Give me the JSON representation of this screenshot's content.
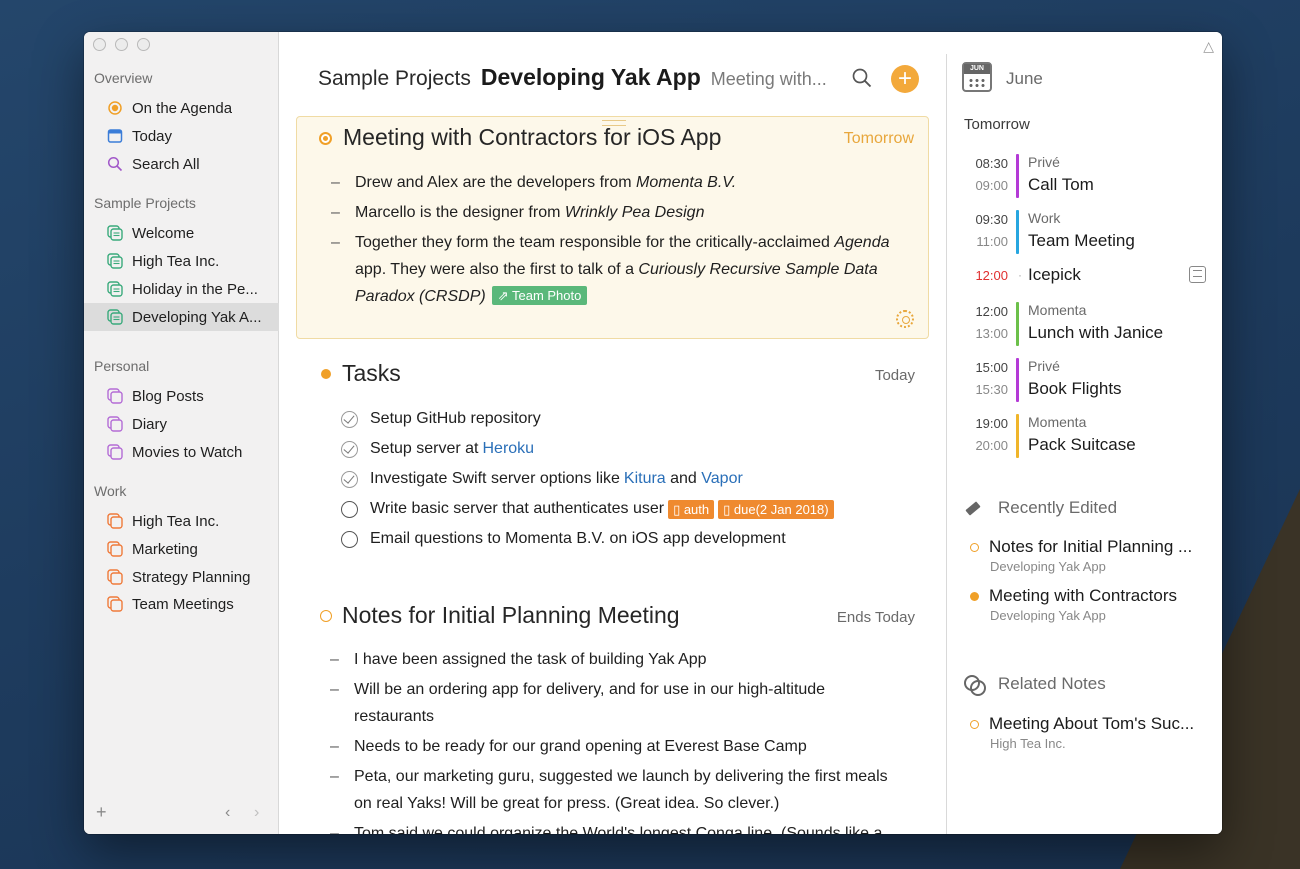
{
  "sidebar": {
    "sections": {
      "overview": "Overview",
      "sample_projects": "Sample Projects",
      "personal": "Personal",
      "work": "Work"
    },
    "overview_items": [
      {
        "label": "On the Agenda",
        "icon": "agenda-icon"
      },
      {
        "label": "Today",
        "icon": "calendar-today-icon"
      },
      {
        "label": "Search All",
        "icon": "search-icon"
      }
    ],
    "sample_items": [
      {
        "label": "Welcome"
      },
      {
        "label": "High Tea Inc."
      },
      {
        "label": "Holiday in the Pe..."
      },
      {
        "label": "Developing Yak A..."
      }
    ],
    "personal_items": [
      {
        "label": "Blog Posts"
      },
      {
        "label": "Diary"
      },
      {
        "label": "Movies to Watch"
      }
    ],
    "work_items": [
      {
        "label": "High Tea Inc."
      },
      {
        "label": "Marketing"
      },
      {
        "label": "Strategy Planning"
      },
      {
        "label": "Team Meetings"
      }
    ],
    "bottom": {
      "add": "+",
      "back": "‹",
      "forward": "›"
    },
    "colors": {
      "sample": "#3aaa7c",
      "personal": "#b46cd6",
      "work": "#ef7a3a",
      "agenda": "#f0a028",
      "today": "#3b7dd8",
      "search": "#a157c9"
    }
  },
  "header": {
    "project": "Sample Projects",
    "title": "Developing Yak App",
    "subtitle": "Meeting with...",
    "add_label": "+"
  },
  "notes": {
    "meeting": {
      "title": "Meeting with Contractors for iOS App",
      "date": "Tomorrow",
      "b1_pre": "Drew and Alex are the developers from ",
      "b1_em": "Momenta B.V.",
      "b2_pre": "Marcello is the designer from ",
      "b2_em": "Wrinkly Pea Design",
      "b3_pre": "Together they form the team responsible for the critically-acclaimed ",
      "b3_em": "Agenda",
      "b3_mid": " app. They were also the first to talk of a ",
      "b3_em2": "Curiously Recursive Sample Data Paradox (CRSDP)",
      "b3_tag": "Team Photo"
    },
    "tasks": {
      "title": "Tasks",
      "date": "Today",
      "t1": "Setup GitHub repository",
      "t2_pre": "Setup server at ",
      "t2_link": "Heroku",
      "t3_pre": "Investigate Swift server options like ",
      "t3_link1": "Kitura",
      "t3_mid": " and ",
      "t3_link2": "Vapor",
      "t4": "Write basic server that authenticates user",
      "t4_tag1": "auth",
      "t4_tag2": "due(2 Jan 2018)",
      "t5": "Email questions to Momenta B.V. on iOS app development"
    },
    "planning": {
      "title": "Notes for Initial Planning Meeting",
      "date": "Ends Today",
      "b1": "I have been assigned the task of building Yak App",
      "b2": "Will be an ordering app for delivery, and for use in our high-altitude restaurants",
      "b3": "Needs to be ready for our grand opening at Everest Base Camp",
      "b4": "Peta, our marketing guru, suggested we launch by delivering the first meals on real Yaks! Will be great for press. (Great idea. So clever.)",
      "b5": "Tom said we could organize the World's longest Conga line. (Sounds like a"
    }
  },
  "calendar": {
    "icon_month": "JUN",
    "month": "June",
    "day_label": "Tomorrow",
    "events": [
      {
        "start": "08:30",
        "end": "09:00",
        "calendar": "Privé",
        "title": "Call Tom",
        "color": "#b43ad6"
      },
      {
        "start": "09:30",
        "end": "11:00",
        "calendar": "Work",
        "title": "Team Meeting",
        "color": "#27a6e0"
      },
      {
        "start": "12:00",
        "end": "13:00",
        "calendar": "Momenta",
        "title": "Lunch with Janice",
        "color": "#6cc04a"
      },
      {
        "start": "15:00",
        "end": "15:30",
        "calendar": "Privé",
        "title": "Book Flights",
        "color": "#b43ad6"
      },
      {
        "start": "19:00",
        "end": "20:00",
        "calendar": "Momenta",
        "title": "Pack Suitcase",
        "color": "#f0b52a"
      }
    ],
    "single_event": {
      "time": "12:00",
      "title": "Icepick"
    }
  },
  "recently_edited": {
    "label": "Recently Edited",
    "items": [
      {
        "title": "Notes for Initial Planning ...",
        "project": "Developing Yak App"
      },
      {
        "title": "Meeting with Contractors",
        "project": "Developing Yak App"
      }
    ]
  },
  "related_notes": {
    "label": "Related Notes",
    "items": [
      {
        "title": "Meeting About Tom's Suc...",
        "project": "High Tea Inc."
      }
    ]
  }
}
